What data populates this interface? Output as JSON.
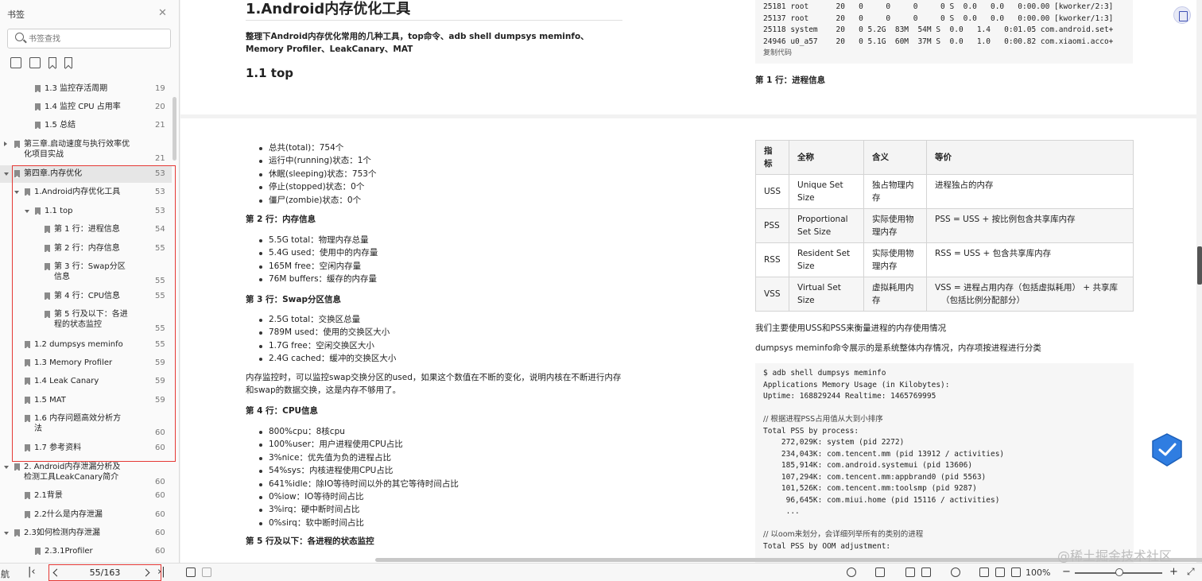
{
  "sidebar": {
    "title": "书签",
    "search_placeholder": "书签查找",
    "toc": [
      {
        "label": "1.3 监控存活周期",
        "page": "19"
      },
      {
        "label": "1.4 监控 CPU 占用率",
        "page": "20"
      },
      {
        "label": "1.5 总结",
        "page": "21"
      },
      {
        "label_line1": "第三章.启动速度与执行效率优",
        "label_line2": "化项目实战",
        "page": "21"
      },
      {
        "label": "第四章.内存优化",
        "page": "53"
      },
      {
        "label": "1.Android内存优化工具",
        "page": "53"
      },
      {
        "label": "1.1 top",
        "page": "53"
      },
      {
        "label": "第 1 行：进程信息",
        "page": "54"
      },
      {
        "label": "第 2 行：内存信息",
        "page": "55"
      },
      {
        "label_line1": "第 3 行：Swap分区",
        "label_line2": "信息",
        "page": "55"
      },
      {
        "label": "第 4 行：CPU信息",
        "page": "55"
      },
      {
        "label_line1": "第 5 行及以下：各进",
        "label_line2": "程的状态监控",
        "page": "55"
      },
      {
        "label": "1.2 dumpsys meminfo",
        "page": "55"
      },
      {
        "label": "1.3 Memory Profiler",
        "page": "59"
      },
      {
        "label": "1.4 Leak Canary",
        "page": "59"
      },
      {
        "label": "1.5 MAT",
        "page": "59"
      },
      {
        "label_line1": "1.6 内存问题高效分析方",
        "label_line2": "法",
        "page": "60"
      },
      {
        "label": "1.7 参考资料",
        "page": "60"
      },
      {
        "label_line1": "2. Android内存泄漏分析及",
        "label_line2": "检测工具LeakCanary简介",
        "page": "60"
      },
      {
        "label": "2.1背景",
        "page": "60"
      },
      {
        "label": "2.2什么是内存泄漏",
        "page": "60"
      },
      {
        "label": "2.3如何检测内存泄漏",
        "page": "60"
      },
      {
        "label": "2.3.1Profiler",
        "page": "60"
      }
    ]
  },
  "page1": {
    "title": "1.Android内存优化工具",
    "intro": "整理下Android内存优化常用的几种工具，top命令、adb shell dumpsys meminfo、Memory Profiler、LeakCanary、MAT",
    "subtitle": "1.1 top",
    "code_lines": [
      "25181 root      20   0     0     0     0 S  0.0   0.0   0:00.00 [kworker/2:3]",
      "25137 root      20   0     0     0     0 S  0.0   0.0   0:00.00 [kworker/1:3]",
      "25118 system    20   0 5.2G  83M  54M S  0.0   1.4   0:01.05 com.android.set+",
      "24946 u0_a57    20   0 5.1G  60M  37M S  0.0   1.0   0:00.82 com.xiaomi.acco+"
    ],
    "copy_label": "复制代码",
    "row1_heading": "第 1 行：进程信息"
  },
  "page2": {
    "list1": [
      "总共(total)：754个",
      "运行中(running)状态：1个",
      "休眠(sleeping)状态：753个",
      "停止(stopped)状态：0个",
      "僵尸(zombie)状态：0个"
    ],
    "h_row2": "第 2 行：内存信息",
    "list2": [
      "5.5G total：物理内存总量",
      "5.4G used：使用中的内存量",
      "165M free：空闲内存量",
      "76M buffers：缓存的内存量"
    ],
    "h_row3": "第 3 行：Swap分区信息",
    "list3": [
      "2.5G total：交换区总量",
      "789M used：使用的交换区大小",
      "1.7G free：空闲交换区大小",
      "2.4G cached：缓冲的交换区大小"
    ],
    "swap_note_line1": "内存监控时，可以监控swap交换分区的used，如果这个数值在不断的变化，说明内核在不断进行内存",
    "swap_note_line2": "和swap的数据交换，这是内存不够用了。",
    "h_row4": "第 4 行：CPU信息",
    "list4": [
      "800%cpu：8核cpu",
      "100%user：用户进程使用CPU占比",
      "3%nice：优先值为负的进程占比",
      "54%sys：内核进程使用CPU占比",
      "641%idle：除IO等待时间以外的其它等待时间占比",
      "0%iow：IO等待时间占比",
      "3%irq：硬中断时间占比",
      "0%sirq：软中断时间占比"
    ],
    "h_row5": "第 5 行及以下：各进程的状态监控",
    "table_headers": [
      "指标",
      "全称",
      "含义",
      "等价"
    ],
    "table_rows": [
      {
        "k": "USS",
        "full_1": "Unique Set",
        "full_2": "Size",
        "mean_1": "独占物理内",
        "mean_2": "存",
        "eq_1": "进程独占的内存",
        "eq_2": ""
      },
      {
        "k": "PSS",
        "full_1": "Proportional",
        "full_2": "Set Size",
        "mean_1": "实际使用物",
        "mean_2": "理内存",
        "eq_1": "PSS = USS + 按比例包含共享库内存",
        "eq_2": ""
      },
      {
        "k": "RSS",
        "full_1": "Resident Set",
        "full_2": "Size",
        "mean_1": "实际使用物",
        "mean_2": "理内存",
        "eq_1": "RSS = USS + 包含共享库内存",
        "eq_2": ""
      },
      {
        "k": "VSS",
        "full_1": "Virtual Set",
        "full_2": "Size",
        "mean_1": "虚拟耗用内",
        "mean_2": "存",
        "eq_1": "VSS = 进程占用内存（包括虚拟耗用） + 共享库",
        "eq_2": "（包括比例分配部分）"
      }
    ],
    "note1": "我们主要使用USS和PSS来衡量进程的内存使用情况",
    "note2": "dumpsys meminfo命令展示的是系统整体内存情况，内存项按进程进行分类",
    "code2_lines": [
      "$ adb shell dumpsys meminfo",
      "Applications Memory Usage (in Kilobytes):",
      "Uptime: 168829244 Realtime: 1465769995",
      "",
      "// 根据进程PSS占用值从大到小排序",
      "Total PSS by process:",
      "    272,029K: system (pid 2272)",
      "    234,043K: com.tencent.mm (pid 13912 / activities)",
      "    185,914K: com.android.systemui (pid 13606)",
      "    107,294K: com.tencent.mm:appbrand0 (pid 5563)",
      "    101,526K: com.tencent.mm:toolsmp (pid 9287)",
      "     96,645K: com.miui.home (pid 15116 / activities)",
      "     ...",
      "",
      "// 以oom来划分，会详细列举所有的类别的进程",
      "Total PSS by OOM adjustment:"
    ]
  },
  "statusbar": {
    "left_label": "航",
    "page_indicator": "55/163",
    "zoom": "100%"
  },
  "watermark": "@稀土掘金技术社区"
}
